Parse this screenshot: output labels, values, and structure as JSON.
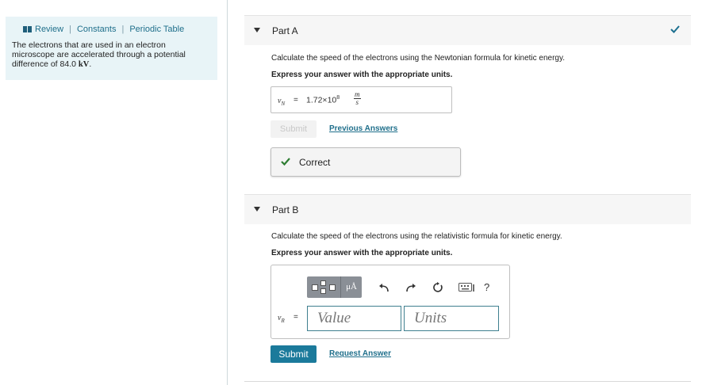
{
  "sidebar": {
    "links": [
      "Review",
      "Constants",
      "Periodic Table"
    ],
    "problem_text": "The electrons that are used in an electron microscope are accelerated through a potential difference of 84.0",
    "problem_unit": "kV",
    "problem_end": "."
  },
  "part_a": {
    "title": "Part A",
    "prompt": "Calculate the speed of the electrons using the Newtonian formula for kinetic energy.",
    "instruction": "Express your answer with the appropriate units.",
    "variable": "v",
    "variable_sub": "N",
    "equals": "=",
    "answer_mantissa": "1.72×10",
    "answer_exponent": "8",
    "unit_num": "m",
    "unit_den": "s",
    "submit_label": "Submit",
    "previous_answers_label": "Previous Answers",
    "result_label": "Correct",
    "status_color": "#2e7d32"
  },
  "part_b": {
    "title": "Part B",
    "prompt": "Calculate the speed of the electrons using the relativistic formula for kinetic energy.",
    "instruction": "Express your answer with the appropriate units.",
    "units_button_label": "μÅ",
    "help_label": "?",
    "variable": "v",
    "variable_sub": "R",
    "equals": "=",
    "value_placeholder": "Value",
    "units_placeholder": "Units",
    "submit_label": "Submit",
    "request_answer_label": "Request Answer"
  },
  "colors": {
    "accent": "#1b7a9b",
    "link": "#1f6f8b",
    "info_bg": "#e8f4f7"
  }
}
